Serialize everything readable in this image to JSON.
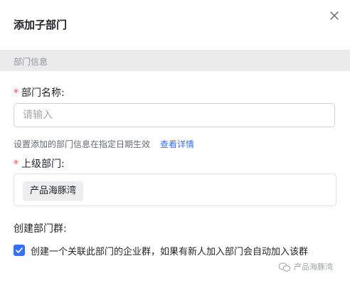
{
  "dialog": {
    "title": "添加子部门",
    "section_header": "部门信息",
    "name_field": {
      "required_mark": "*",
      "label": "部门名称:",
      "value": "",
      "placeholder": "请输入"
    },
    "hint_text": "设置添加的部门信息在指定日期生效",
    "hint_link": "查看详情",
    "parent_field": {
      "required_mark": "*",
      "label": "上级部门:",
      "selected_tag": "产品海豚湾"
    },
    "group_section": {
      "label": "创建部门群:",
      "checkbox_checked": true,
      "checkbox_label": "创建一个关联此部门的企业群，如果有新人加入部门会自动加入该群"
    }
  },
  "watermark": {
    "icon": "wechat-icon",
    "text": "产品海豚湾"
  },
  "colors": {
    "accent": "#3370ff",
    "required": "#f54a45",
    "section_bg": "#ebebeb"
  }
}
